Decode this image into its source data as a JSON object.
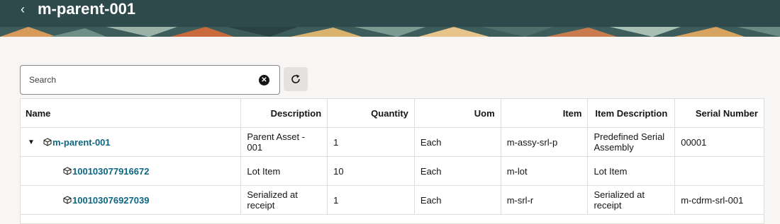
{
  "header": {
    "title": "m-parent-001",
    "back_icon": "chevron-left-icon",
    "background_color": "#2f4a4c"
  },
  "search": {
    "placeholder": "Search",
    "value": "",
    "clear_icon": "clear-icon",
    "refresh_icon": "refresh-icon"
  },
  "table": {
    "columns": [
      "Name",
      "Description",
      "Quantity",
      "Uom",
      "Item",
      "Item Description",
      "Serial Number"
    ],
    "rows": [
      {
        "name": "m-parent-001",
        "description": "Parent Asset - 001",
        "quantity": "1",
        "uom": "Each",
        "item": "m-assy-srl-p",
        "item_description": "Predefined Serial Assembly",
        "serial_number": "00001",
        "expanded": true
      },
      {
        "name": "100103077916672",
        "description": "Lot Item",
        "quantity": "10",
        "uom": "Each",
        "item": "m-lot",
        "item_description": "Lot Item",
        "serial_number": ""
      },
      {
        "name": "100103076927039",
        "description": "Serialized at receipt",
        "quantity": "1",
        "uom": "Each",
        "item": "m-srl-r",
        "item_description": "Serialized at receipt",
        "serial_number": "m-cdrm-srl-001"
      }
    ]
  },
  "colors": {
    "link": "#0e6582",
    "header": "#2f4a4c"
  }
}
